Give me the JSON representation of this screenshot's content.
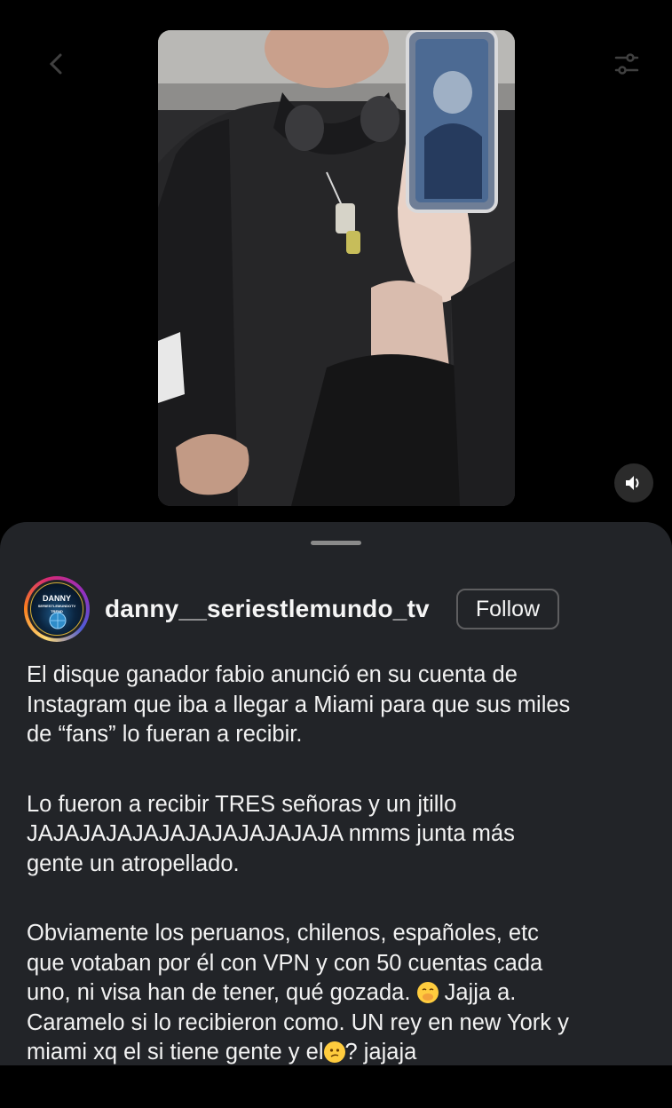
{
  "post": {
    "author": {
      "username": "danny__seriestlemundo_tv",
      "avatar_text": [
        "DANNY",
        "SERIESTLEMUNDOTV",
        "TREND"
      ]
    },
    "follow_label": "Follow",
    "caption_lines": [
      [
        "El disque ganador fabio anunció en su cuenta de",
        "Instagram que iba a llegar a Miami para que sus miles",
        "de “fans” lo fueran a recibir."
      ],
      [
        "Lo fueron a recibir TRES señoras y un jtillo",
        "JAJAJAJAJAJAJAJAJAJAJAJA nmms junta más",
        "gente un atropellado."
      ],
      [
        "Obviamente los peruanos, chilenos, españoles, etc",
        "que votaban por él con VPN y con 50 cuentas cada",
        "uno, ni visa han de tener, qué gozada. ",
        "Caramelo si lo recibieron como. UN rey en new York y",
        "miami xq el si tiene gente y el",
        "? jajaja"
      ]
    ],
    "inline_text": {
      "after_emoji1": " Jajja a."
    }
  },
  "icons": {
    "back": "chevron-left-icon",
    "settings": "sliders-icon",
    "audio": "speaker-icon",
    "emoji1": "face-with-hand-over-mouth-emoji",
    "emoji2": "confused-face-emoji"
  },
  "colors": {
    "sheet_bg": "#222428",
    "text": "#f2f2f2",
    "follow_border": "#5e5e60"
  }
}
